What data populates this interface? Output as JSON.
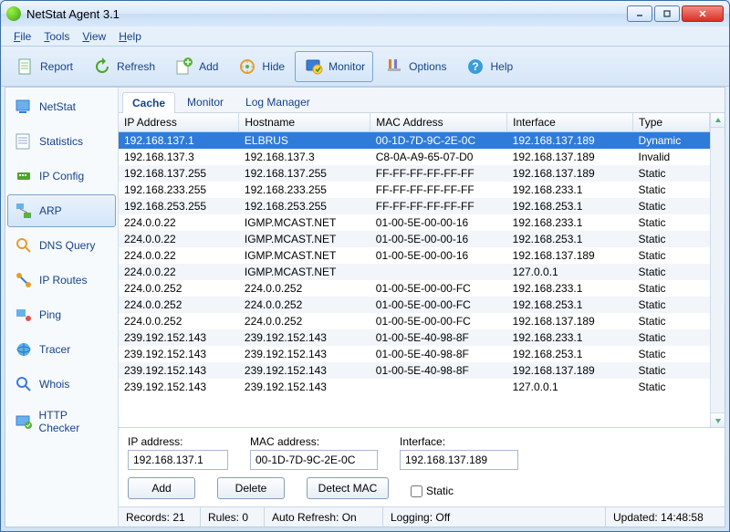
{
  "window": {
    "title": "NetStat Agent 3.1"
  },
  "menu": {
    "file": "File",
    "tools": "Tools",
    "view": "View",
    "help": "Help"
  },
  "toolbar": {
    "report": "Report",
    "refresh": "Refresh",
    "add": "Add",
    "hide": "Hide",
    "monitor": "Monitor",
    "options": "Options",
    "help": "Help"
  },
  "sidebar": {
    "netstat": "NetStat",
    "statistics": "Statistics",
    "ipconfig": "IP Config",
    "arp": "ARP",
    "dnsquery": "DNS Query",
    "iproutes": "IP Routes",
    "ping": "Ping",
    "tracer": "Tracer",
    "whois": "Whois",
    "httpchecker": "HTTP Checker"
  },
  "tabs": {
    "cache": "Cache",
    "monitor": "Monitor",
    "logmgr": "Log Manager"
  },
  "columns": {
    "ip": "IP Address",
    "host": "Hostname",
    "mac": "MAC Address",
    "iface": "Interface",
    "type": "Type"
  },
  "chart_data": {
    "type": "table",
    "columns": [
      "IP Address",
      "Hostname",
      "MAC Address",
      "Interface",
      "Type"
    ],
    "rows": [
      [
        "192.168.137.1",
        "ELBRUS",
        "00-1D-7D-9C-2E-0C",
        "192.168.137.189",
        "Dynamic"
      ],
      [
        "192.168.137.3",
        "192.168.137.3",
        "C8-0A-A9-65-07-D0",
        "192.168.137.189",
        "Invalid"
      ],
      [
        "192.168.137.255",
        "192.168.137.255",
        "FF-FF-FF-FF-FF-FF",
        "192.168.137.189",
        "Static"
      ],
      [
        "192.168.233.255",
        "192.168.233.255",
        "FF-FF-FF-FF-FF-FF",
        "192.168.233.1",
        "Static"
      ],
      [
        "192.168.253.255",
        "192.168.253.255",
        "FF-FF-FF-FF-FF-FF",
        "192.168.253.1",
        "Static"
      ],
      [
        "224.0.0.22",
        "IGMP.MCAST.NET",
        "01-00-5E-00-00-16",
        "192.168.233.1",
        "Static"
      ],
      [
        "224.0.0.22",
        "IGMP.MCAST.NET",
        "01-00-5E-00-00-16",
        "192.168.253.1",
        "Static"
      ],
      [
        "224.0.0.22",
        "IGMP.MCAST.NET",
        "01-00-5E-00-00-16",
        "192.168.137.189",
        "Static"
      ],
      [
        "224.0.0.22",
        "IGMP.MCAST.NET",
        "",
        "127.0.0.1",
        "Static"
      ],
      [
        "224.0.0.252",
        "224.0.0.252",
        "01-00-5E-00-00-FC",
        "192.168.233.1",
        "Static"
      ],
      [
        "224.0.0.252",
        "224.0.0.252",
        "01-00-5E-00-00-FC",
        "192.168.253.1",
        "Static"
      ],
      [
        "224.0.0.252",
        "224.0.0.252",
        "01-00-5E-00-00-FC",
        "192.168.137.189",
        "Static"
      ],
      [
        "239.192.152.143",
        "239.192.152.143",
        "01-00-5E-40-98-8F",
        "192.168.233.1",
        "Static"
      ],
      [
        "239.192.152.143",
        "239.192.152.143",
        "01-00-5E-40-98-8F",
        "192.168.253.1",
        "Static"
      ],
      [
        "239.192.152.143",
        "239.192.152.143",
        "01-00-5E-40-98-8F",
        "192.168.137.189",
        "Static"
      ],
      [
        "239.192.152.143",
        "239.192.152.143",
        "",
        "127.0.0.1",
        "Static"
      ]
    ]
  },
  "form": {
    "ip_label": "IP address:",
    "ip_value": "192.168.137.1",
    "mac_label": "MAC address:",
    "mac_value": "00-1D-7D-9C-2E-0C",
    "iface_label": "Interface:",
    "iface_value": "192.168.137.189",
    "add": "Add",
    "delete": "Delete",
    "detect": "Detect MAC",
    "static": "Static"
  },
  "status": {
    "records": "Records: 21",
    "rules": "Rules: 0",
    "autorefresh": "Auto Refresh: On",
    "logging": "Logging: Off",
    "updated": "Updated: 14:48:58"
  }
}
